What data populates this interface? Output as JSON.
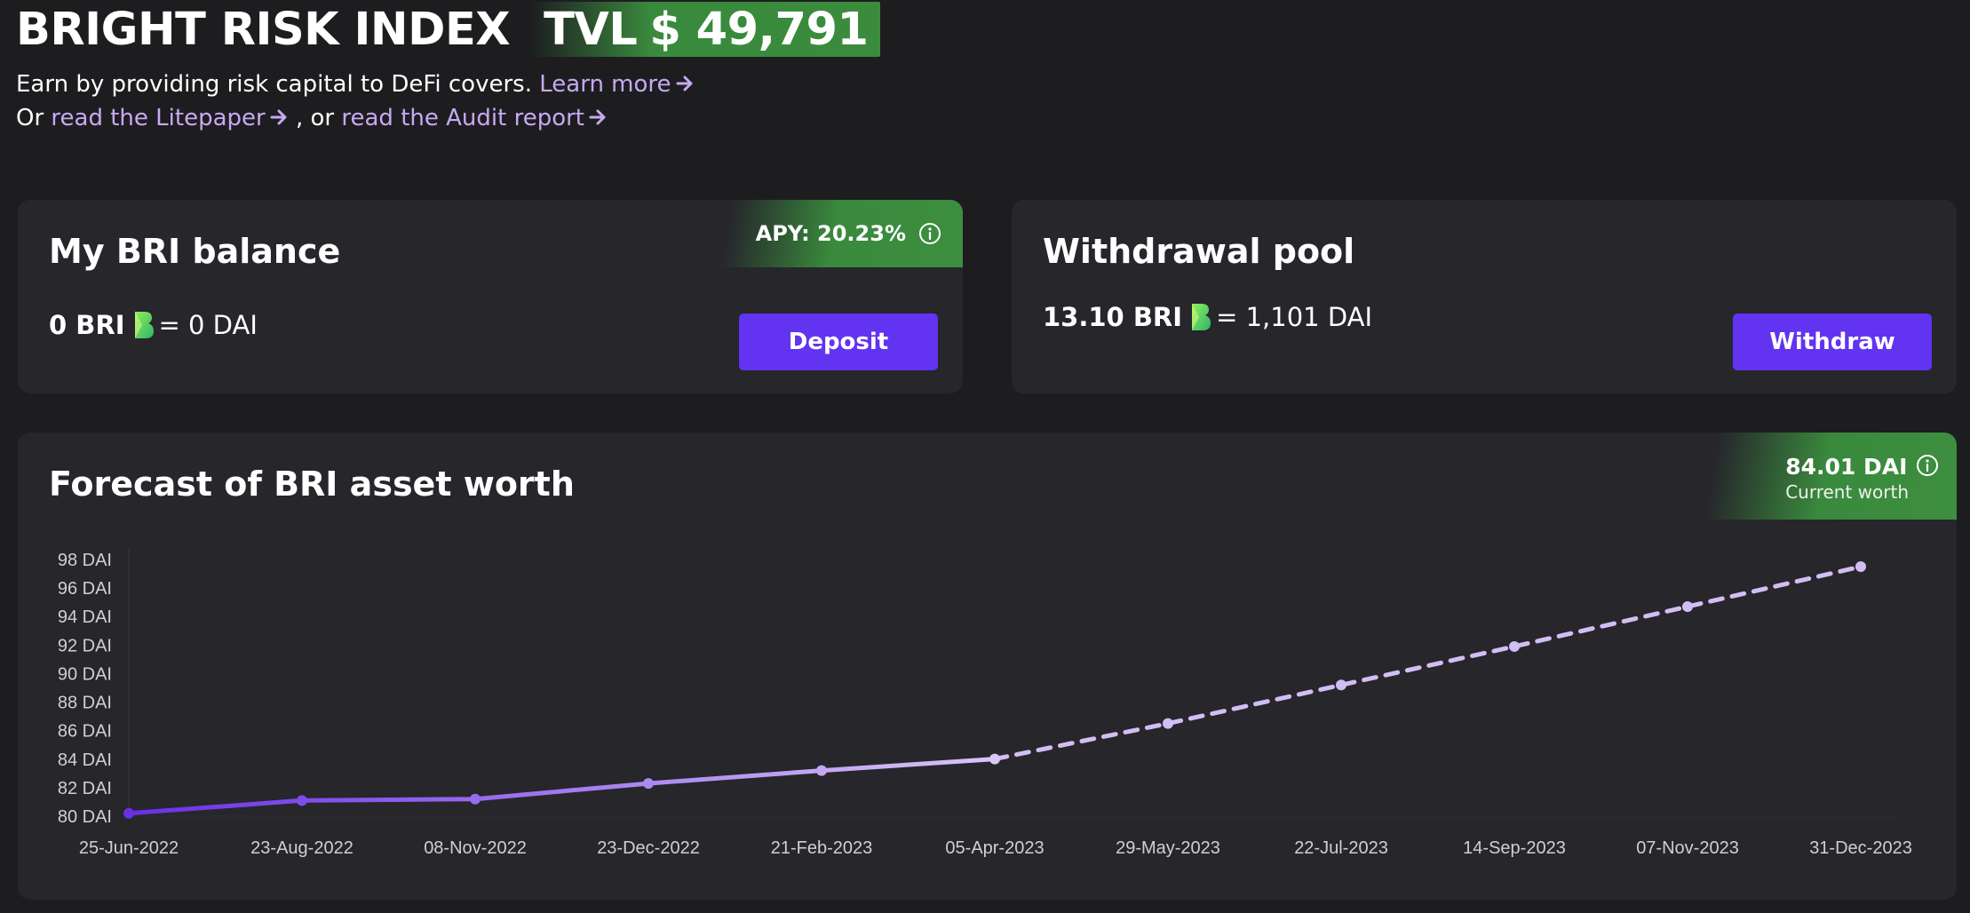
{
  "header": {
    "title": "BRIGHT RISK INDEX",
    "tvl_label": "TVL",
    "tvl_value": "$ 49,791"
  },
  "intro": {
    "line1_text": "Earn by providing risk capital to DeFi covers.",
    "learn_more": "Learn more",
    "line2_prefix": "Or",
    "litepaper_link": "read the Litepaper",
    "line2_mid": ", or",
    "audit_link": "read the Audit report"
  },
  "balance_card": {
    "title": "My BRI balance",
    "apy": "APY: 20.23%",
    "amount": "0 BRI",
    "equals": "= 0 DAI",
    "deposit_label": "Deposit"
  },
  "withdrawal_card": {
    "title": "Withdrawal pool",
    "amount": "13.10 BRI",
    "equals": "= 1,101 DAI",
    "withdraw_label": "Withdraw"
  },
  "forecast_card": {
    "title": "Forecast of BRI asset worth",
    "current_worth_value": "84.01 DAI",
    "current_worth_label": "Current worth"
  },
  "colors": {
    "background": "#1d1d20",
    "card": "#26262b",
    "accent_purple": "#6233f0",
    "link": "#c7a9f2",
    "green_badge": "#3a8a3d",
    "line_start": "#6a2ee6",
    "line_end": "#d9c6f6",
    "forecast_line": "#d2bdf4"
  },
  "icons": {
    "arrow": "arrow-right-icon",
    "info": "info-circle-icon",
    "token": "bri-token-logo"
  },
  "chart_data": {
    "type": "line",
    "x": [
      "25-Jun-2022",
      "23-Aug-2022",
      "08-Nov-2022",
      "23-Dec-2022",
      "21-Feb-2023",
      "05-Apr-2023",
      "29-May-2023",
      "22-Jul-2023",
      "14-Sep-2023",
      "07-Nov-2023",
      "31-Dec-2023"
    ],
    "series": [
      {
        "style": "solid",
        "values": [
          80.2,
          81.1,
          81.2,
          82.3,
          83.2,
          84.01,
          null,
          null,
          null,
          null,
          null
        ]
      },
      {
        "style": "dashed",
        "values": [
          null,
          null,
          null,
          null,
          null,
          84.01,
          86.5,
          89.2,
          91.9,
          94.7,
          97.5
        ]
      }
    ],
    "yticks": [
      "80 DAI",
      "82 DAI",
      "84 DAI",
      "86 DAI",
      "88 DAI",
      "90 DAI",
      "92 DAI",
      "94 DAI",
      "96 DAI",
      "98 DAI"
    ],
    "ylim": [
      80,
      98
    ],
    "grid": false,
    "legend": "none"
  }
}
